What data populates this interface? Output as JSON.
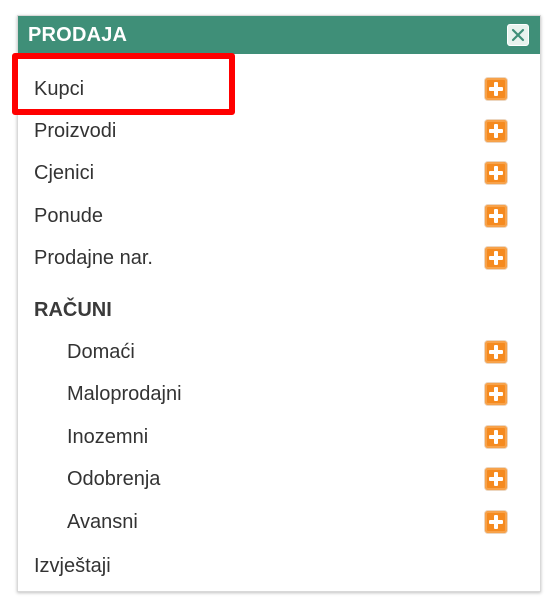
{
  "panel": {
    "title": "PRODAJA",
    "header_color": "#3f8f78",
    "close_icon": "close-icon"
  },
  "menu": {
    "items": [
      {
        "label": "Kupci",
        "has_add": true
      },
      {
        "label": "Proizvodi",
        "has_add": true
      },
      {
        "label": "Cjenici",
        "has_add": true
      },
      {
        "label": "Ponude",
        "has_add": true
      },
      {
        "label": "Prodajne nar.",
        "has_add": true
      }
    ],
    "section": {
      "title": "RAČUNI",
      "items": [
        {
          "label": "Domaći",
          "has_add": true
        },
        {
          "label": "Maloprodajni",
          "has_add": true
        },
        {
          "label": "Inozemni",
          "has_add": true
        },
        {
          "label": "Odobrenja",
          "has_add": true
        },
        {
          "label": "Avansni",
          "has_add": true
        }
      ]
    },
    "footer_item": {
      "label": "Izvještaji"
    }
  },
  "colors": {
    "add_button": "#f58a1f",
    "highlight": "#ff0000"
  },
  "highlight": {
    "target": "Kupci"
  }
}
